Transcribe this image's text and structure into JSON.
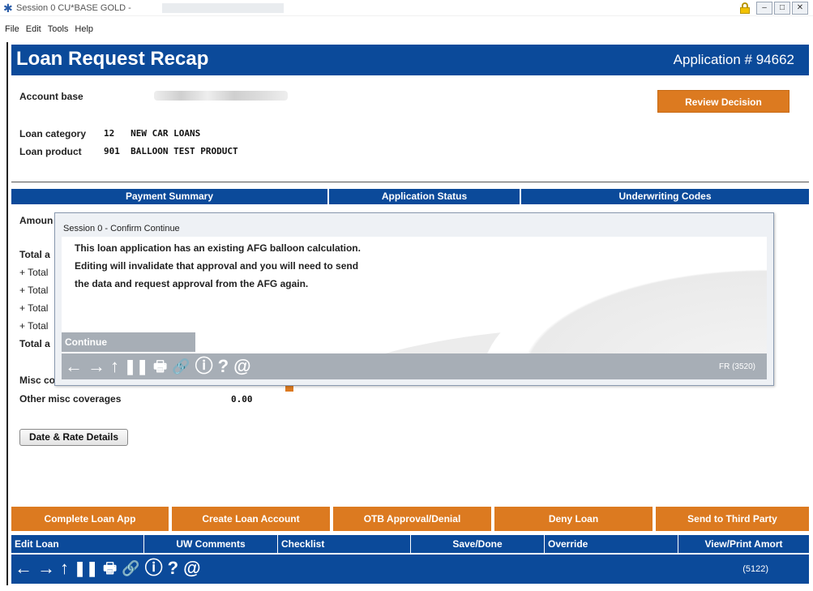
{
  "window": {
    "title": "Session 0 CU*BASE GOLD -",
    "menu": [
      "File",
      "Edit",
      "Tools",
      "Help"
    ],
    "buttons": [
      "–",
      "□",
      "✕"
    ]
  },
  "header": {
    "title": "Loan Request Recap",
    "application": "Application # 94662"
  },
  "info": {
    "account_base_label": "Account base",
    "loan_category_label": "Loan category",
    "loan_category_value": "12   NEW CAR LOANS",
    "loan_product_label": "Loan product",
    "loan_product_value": "901  BALLOON TEST PRODUCT"
  },
  "review_decision": "Review Decision",
  "sections": {
    "payment_summary": "Payment Summary",
    "application_status": "Application Status",
    "underwriting_codes": "Underwriting Codes"
  },
  "background_labels": {
    "amount": "Amoun",
    "total_1": "Total a",
    "plus_total_1": "+ Total",
    "plus_total_2": "+ Total",
    "plus_total_3": "+ Total",
    "plus_total_4": "+ Total",
    "total_2": "Total a",
    "misc": "Misc co",
    "other_misc_label": "Other misc coverages",
    "other_misc_value": "0.00"
  },
  "date_rate_button": "Date & Rate Details",
  "actions": [
    "Complete Loan App",
    "Create Loan Account",
    "OTB Approval/Denial",
    "Deny Loan",
    "Send to Third Party"
  ],
  "functions": [
    "Edit Loan",
    "UW Comments",
    "Checklist",
    "Save/Done",
    "Override",
    "View/Print Amort"
  ],
  "nav_icons": [
    "←",
    "→",
    "↑",
    "❚❚",
    "🖶",
    "🔗",
    "ⓘ",
    "?",
    "@"
  ],
  "screen_code": "(5122)",
  "modal": {
    "title": "Session 0  - Confirm Continue",
    "lines": [
      "This loan application has an existing AFG balloon calculation.",
      "Editing will invalidate that approval and you will need to send",
      "the data and request approval from the AFG again."
    ],
    "continue_label": "Continue",
    "code": "FR (3520)"
  }
}
